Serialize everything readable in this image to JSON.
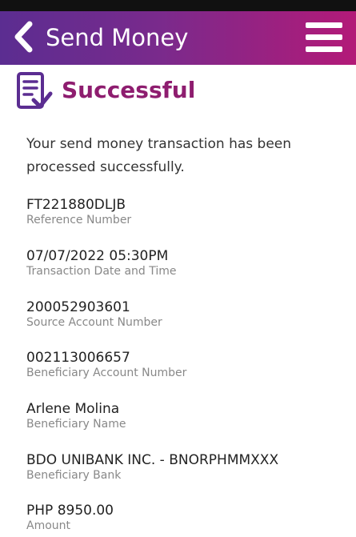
{
  "header": {
    "title": "Send Money",
    "back_icon": "chevron-left-icon",
    "menu_icon": "hamburger-menu-icon",
    "gradient_start": "#5b2d91",
    "gradient_end": "#b31a78"
  },
  "status": {
    "icon": "document-check-icon",
    "title": "Successful",
    "title_color": "#8e1d6f"
  },
  "message": "Your send money transaction has been processed successfully.",
  "fields": [
    {
      "value": "FT221880DLJB",
      "label": "Reference Number"
    },
    {
      "value": "07/07/2022 05:30PM",
      "label": "Transaction Date and Time"
    },
    {
      "value": "200052903601",
      "label": "Source Account Number"
    },
    {
      "value": "002113006657",
      "label": "Beneficiary Account Number"
    },
    {
      "value": "Arlene Molina",
      "label": "Beneficiary Name"
    },
    {
      "value": "BDO UNIBANK INC. - BNORPHMMXXX",
      "label": "Beneficiary Bank"
    },
    {
      "value": "PHP 8950.00",
      "label": "Amount"
    }
  ]
}
